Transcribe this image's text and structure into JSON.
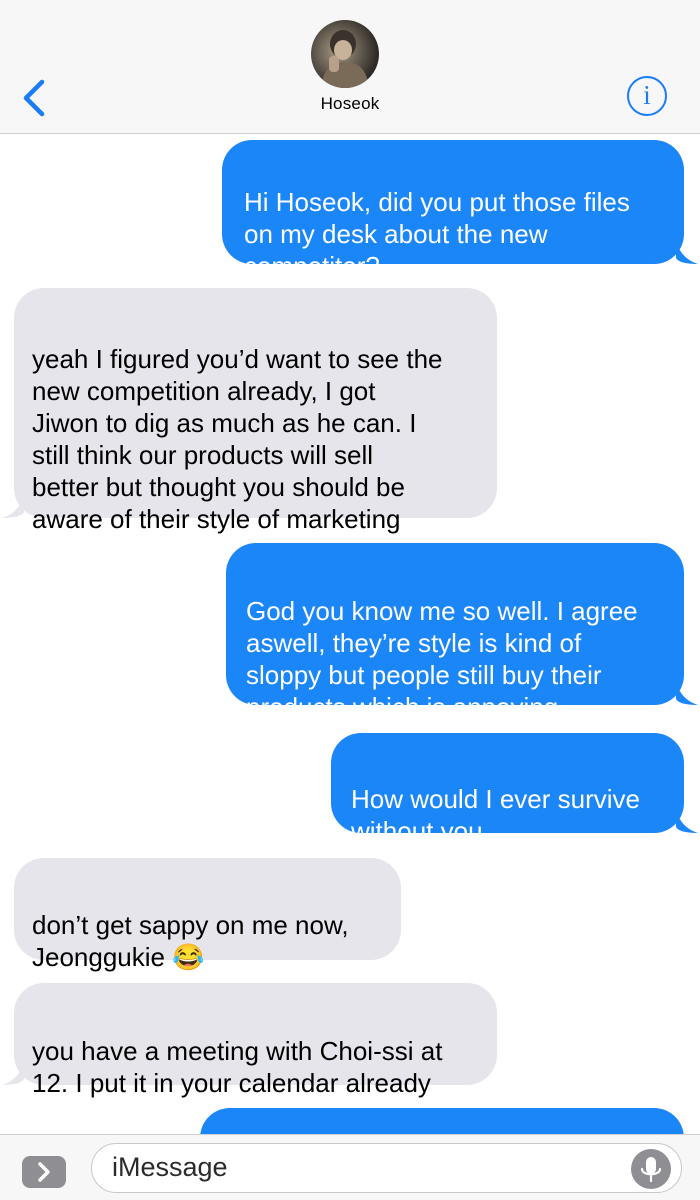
{
  "header": {
    "contact_name": "Hoseok",
    "avatar_icon": "contact-avatar",
    "back_icon": "chevron-left-icon",
    "info_icon": "info-icon",
    "info_glyph": "i",
    "accent_color": "#1a7cf6"
  },
  "conversation": {
    "sent_color": "#1b86f8",
    "received_color": "#e6e5eb",
    "messages": [
      {
        "direction": "sent",
        "text": "Hi Hoseok, did you put those files\non my desk about the new\ncompetitor?"
      },
      {
        "direction": "received",
        "text": "yeah I figured you’d want to see the\nnew competition already, I got\nJiwon to dig as much as he can. I\nstill think our products will sell\nbetter but thought you should be\naware of their style of marketing"
      },
      {
        "direction": "sent",
        "text": "God you know me so well. I agree\naswell, they’re style is kind of\nsloppy but people still buy their\nproducts which is annoying"
      },
      {
        "direction": "sent",
        "text": "How would I ever survive\nwithout you"
      },
      {
        "direction": "received",
        "text": "don’t get sappy on me now,\nJeonggukie 😂"
      },
      {
        "direction": "received",
        "text": "you have a meeting with Choi-ssi at\n12. I put it in your calendar already"
      },
      {
        "direction": "sent",
        "text": ""
      }
    ]
  },
  "input_bar": {
    "placeholder": "iMessage",
    "apps_icon": "chevron-right-icon",
    "mic_icon": "microphone-icon"
  }
}
